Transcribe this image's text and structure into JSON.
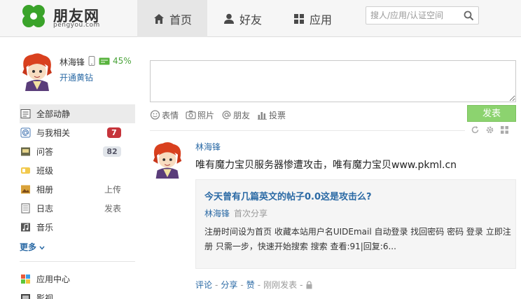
{
  "header": {
    "logo_text": "朋友网",
    "logo_sub": "pengyou.com",
    "nav": [
      {
        "label": "首页",
        "icon": "home-icon"
      },
      {
        "label": "好友",
        "icon": "person-icon"
      },
      {
        "label": "应用",
        "icon": "grid-icon"
      }
    ],
    "search_placeholder": "搜人/应用/认证空间"
  },
  "profile": {
    "name": "林海锋",
    "vip_percent": "45%",
    "vip_link": "开通黄钻"
  },
  "menu": [
    {
      "label": "全部动静",
      "icon": "feed-icon"
    },
    {
      "label": "与我相关",
      "icon": "at-icon",
      "badge": "7"
    },
    {
      "label": "问答",
      "icon": "qa-icon",
      "count": "82"
    },
    {
      "label": "班级",
      "icon": "class-icon"
    },
    {
      "label": "相册",
      "icon": "album-icon",
      "extra": "上传"
    },
    {
      "label": "日志",
      "icon": "diary-icon",
      "extra": "发表"
    },
    {
      "label": "音乐",
      "icon": "music-icon"
    }
  ],
  "more_label": "更多",
  "apps": [
    {
      "label": "应用中心",
      "icon": "app-center-icon"
    },
    {
      "label": "影视",
      "icon": "video-icon"
    }
  ],
  "composer": {
    "tools": [
      {
        "label": "表情",
        "icon": "smile-icon"
      },
      {
        "label": "照片",
        "icon": "camera-icon"
      },
      {
        "label": "朋友",
        "icon": "at-icon"
      },
      {
        "label": "投票",
        "icon": "vote-icon"
      }
    ],
    "post_label": "发表"
  },
  "feed": {
    "author": "林海锋",
    "text": "唯有魔力宝贝服务器惨遭攻击，唯有魔力宝贝www.pkml.cn",
    "card": {
      "title": "今天曾有几篇英文的帖子0.0这是攻击么?",
      "author": "林海锋",
      "author_sub": "首次分享",
      "body": "注册时间设为首页 收藏本站用户名UIDEmail 自动登录 找回密码 密码 登录 立即注册 只需一步，快速开始搜索 搜索 查看:91|回复:6..."
    },
    "actions": {
      "comment": "评论",
      "share": "分享",
      "like": "赞",
      "time": "刚刚发表"
    }
  }
}
